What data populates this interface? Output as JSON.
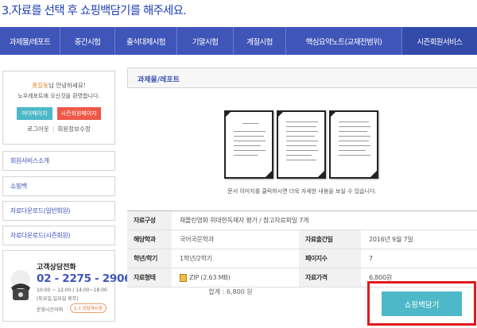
{
  "heading": "3.자료를 선택 후 쇼핑백담기를 해주세요.",
  "nav": [
    "과제물/레포트",
    "중간시험",
    "출석대체시험",
    "기말시험",
    "계절시험",
    "핵심요약노트(교재전범위)",
    "시즌회원서비스"
  ],
  "user": {
    "name": "홍길동",
    "greet_suffix": "님 안녕하세요!",
    "welcome": "노우레포트에 오신것을 환영합니다.",
    "mypage": "마이페이지",
    "season_page": "시즌회원페이지",
    "logout": "로그아웃",
    "edit": "회원정보수정"
  },
  "side_menu": [
    "회원서비스소개",
    "쇼핑백",
    "자료다운로드(일반회원)",
    "자료다운로드(시즌회원)"
  ],
  "support": {
    "title": "고객상담전화",
    "phone": "02 - 2275 - 2906",
    "hours1": "10:00 ~ 12:00 / 14:00~18:00",
    "hours2": "(토요일,일요일 휴무)",
    "hours_label": "운영시간이외",
    "badge": "1:1 상담게시판"
  },
  "section_title": "과제물/레포트",
  "preview_caption": "문서 이미지를 클릭하시면 더욱 자세한 내용을 보실 수 있습니다.",
  "details": {
    "composition_label": "자료구성",
    "composition": "채플린영화 위대한독재자 평가 / 참고자료파일 7개",
    "dept_label": "해당학과",
    "dept": "국어국문학과",
    "date_label": "자료출간일",
    "date": "2016년 9월 7일",
    "grade_label": "학년/학기",
    "grade": "1학년/2학기",
    "pages_label": "페이지수",
    "pages": "7",
    "format_label": "자료형태",
    "format": "ZIP (2.63 MB)",
    "price_label": "자료가격",
    "price": "6,800원"
  },
  "total": "합계 : 6,800 원",
  "cart_button": "쇼핑백담기",
  "colors": {
    "brand": "#3f55b8",
    "accent": "#4db8c8",
    "highlight": "#e0191d"
  }
}
